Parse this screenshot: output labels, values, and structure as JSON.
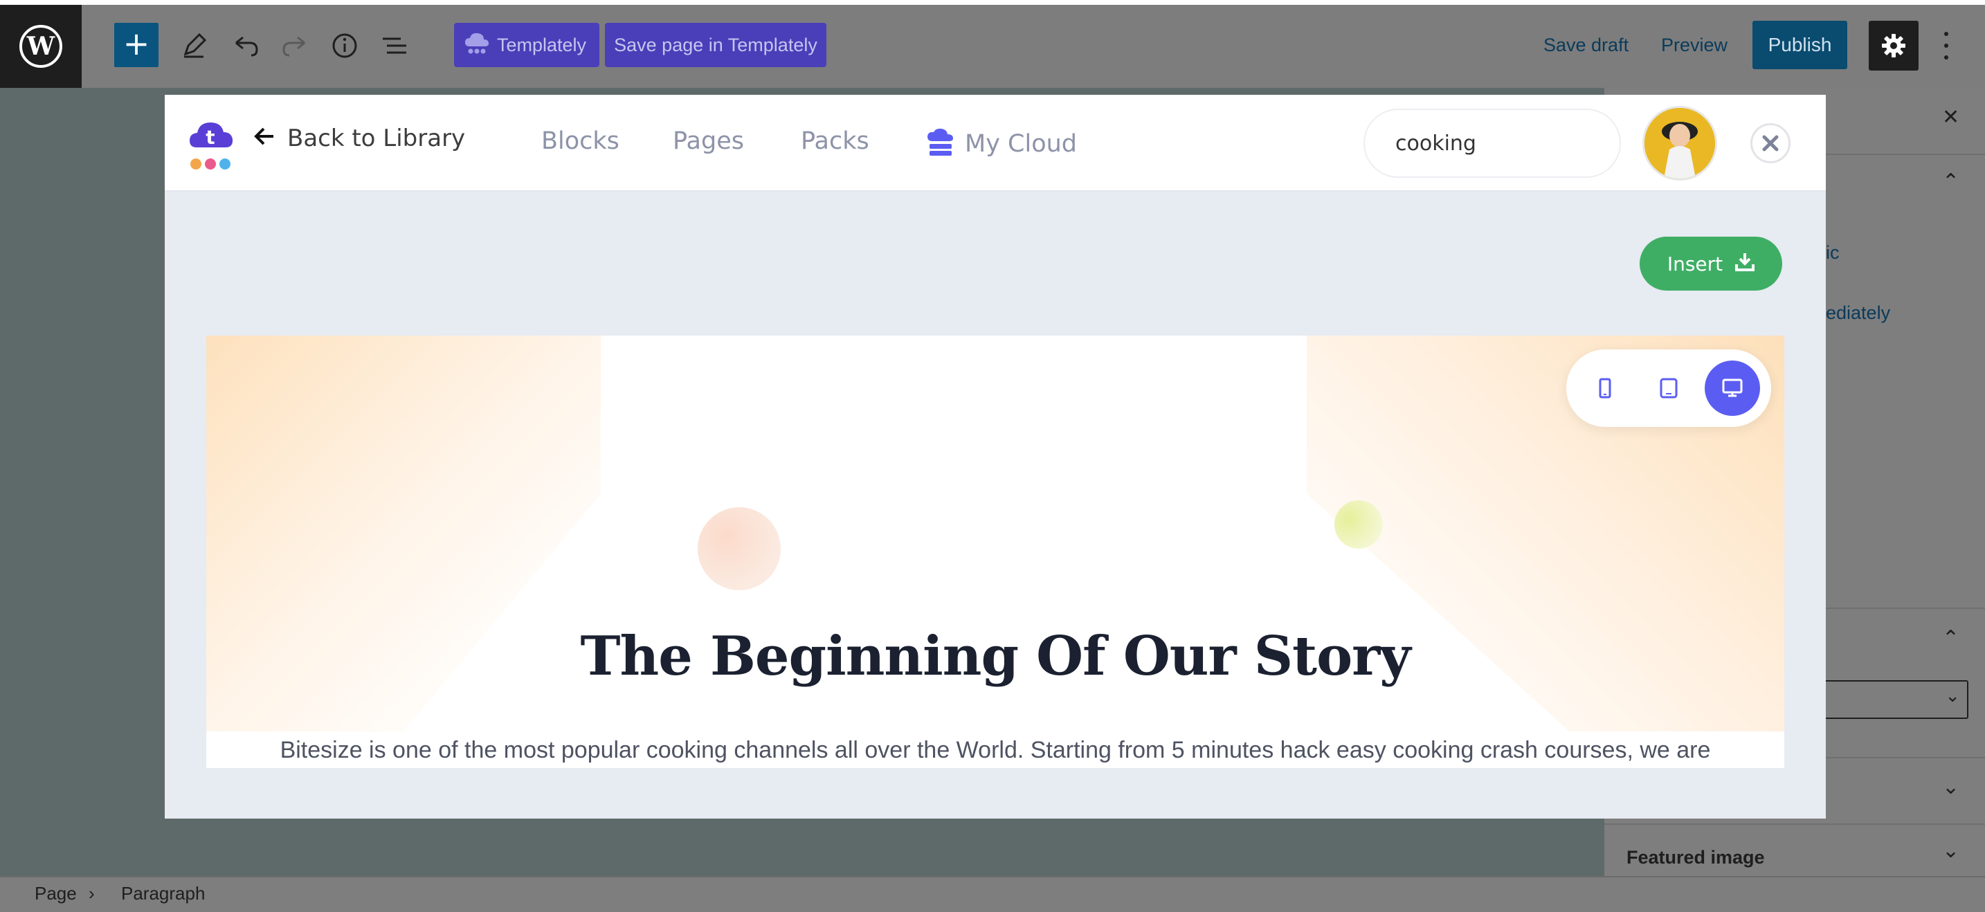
{
  "topbar": {
    "templately_label": "Templately",
    "save_templately_label": "Save page in Templately",
    "save_draft": "Save draft",
    "preview": "Preview",
    "publish": "Publish"
  },
  "sidebar": {
    "fragment_1": "ic",
    "fragment_2": "ediately",
    "featured_image": "Featured image"
  },
  "breadcrumb": {
    "items": [
      "Page",
      "Paragraph"
    ]
  },
  "modal": {
    "back_label": "Back to Library",
    "tabs": [
      "Blocks",
      "Pages",
      "Packs",
      "My Cloud"
    ],
    "search_value": "cooking",
    "insert_label": "Insert"
  },
  "preview": {
    "title": "The Beginning Of Our Story",
    "text": "Bitesize is one of the most popular cooking channels all over the World. Starting from 5 minutes hack easy cooking crash courses, we are"
  },
  "colors": {
    "templately_purple": "#4a3fb8",
    "insert_green": "#3fae65",
    "device_active": "#5b5df2",
    "publish_blue": "#0a4b70"
  }
}
